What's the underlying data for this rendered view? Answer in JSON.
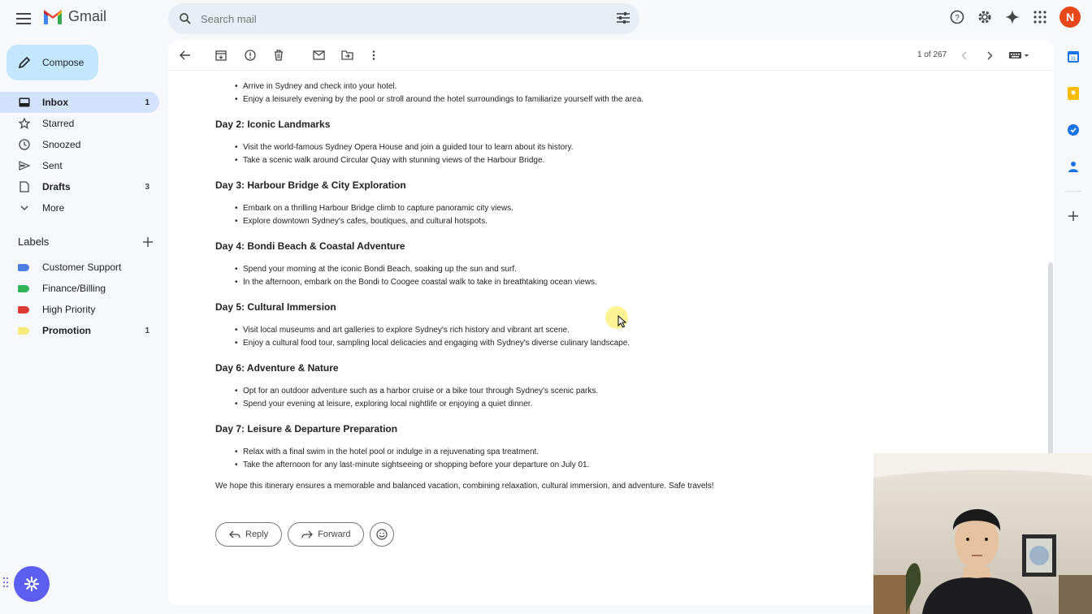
{
  "app": {
    "name": "Gmail"
  },
  "search": {
    "placeholder": "Search mail"
  },
  "user": {
    "initial": "N",
    "avatar_color": "#e8471a"
  },
  "compose": {
    "label": "Compose"
  },
  "nav": [
    {
      "label": "Inbox",
      "count": "1",
      "icon": "inbox-icon"
    },
    {
      "label": "Starred",
      "count": "",
      "icon": "star-icon"
    },
    {
      "label": "Snoozed",
      "count": "",
      "icon": "clock-icon"
    },
    {
      "label": "Sent",
      "count": "",
      "icon": "send-icon"
    },
    {
      "label": "Drafts",
      "count": "3",
      "icon": "draft-icon"
    },
    {
      "label": "More",
      "count": "",
      "icon": "chevron-down-icon"
    }
  ],
  "labels": {
    "title": "Labels",
    "items": [
      {
        "label": "Customer Support",
        "count": "",
        "color": "#4a7ee0"
      },
      {
        "label": "Finance/Billing",
        "count": "",
        "color": "#2fb457"
      },
      {
        "label": "High Priority",
        "count": "",
        "color": "#dd3b35"
      },
      {
        "label": "Promotion",
        "count": "1",
        "color": "#f8ea7a"
      }
    ]
  },
  "toolbar": {
    "pager": "1 of 267"
  },
  "email": {
    "intro_bullets": [
      "Arrive in Sydney and check into your hotel.",
      "Enjoy a leisurely evening by the pool or stroll around the hotel surroundings to familiarize yourself with the area."
    ],
    "days": [
      {
        "title": "Day 2: Iconic Landmarks",
        "bullets": [
          "Visit the world-famous Sydney Opera House and join a guided tour to learn about its history.",
          "Take a scenic walk around Circular Quay with stunning views of the Harbour Bridge."
        ]
      },
      {
        "title": "Day 3: Harbour Bridge & City Exploration",
        "bullets": [
          "Embark on a thrilling Harbour Bridge climb to capture panoramic city views.",
          "Explore downtown Sydney's cafes, boutiques, and cultural hotspots."
        ]
      },
      {
        "title": "Day 4: Bondi Beach & Coastal Adventure",
        "bullets": [
          "Spend your morning at the iconic Bondi Beach, soaking up the sun and surf.",
          "In the afternoon, embark on the Bondi to Coogee coastal walk to take in breathtaking ocean views."
        ]
      },
      {
        "title": "Day 5: Cultural Immersion",
        "bullets": [
          "Visit local museums and art galleries to explore Sydney's rich history and vibrant art scene.",
          "Enjoy a cultural food tour, sampling local delicacies and engaging with Sydney's diverse culinary landscape."
        ]
      },
      {
        "title": "Day 6: Adventure & Nature",
        "bullets": [
          "Opt for an outdoor adventure such as a harbor cruise or a bike tour through Sydney's scenic parks.",
          "Spend your evening at leisure, exploring local nightlife or enjoying a quiet dinner."
        ]
      },
      {
        "title": "Day 7: Leisure & Departure Preparation",
        "bullets": [
          "Relax with a final swim in the hotel pool or indulge in a rejuvenating spa treatment.",
          "Take the afternoon for any last-minute sightseeing or shopping before your departure on July 01."
        ]
      }
    ],
    "closing": "We hope this itinerary ensures a memorable and balanced vacation, combining relaxation, cultural immersion, and adventure. Safe travels!"
  },
  "actions": {
    "reply": "Reply",
    "forward": "Forward"
  }
}
